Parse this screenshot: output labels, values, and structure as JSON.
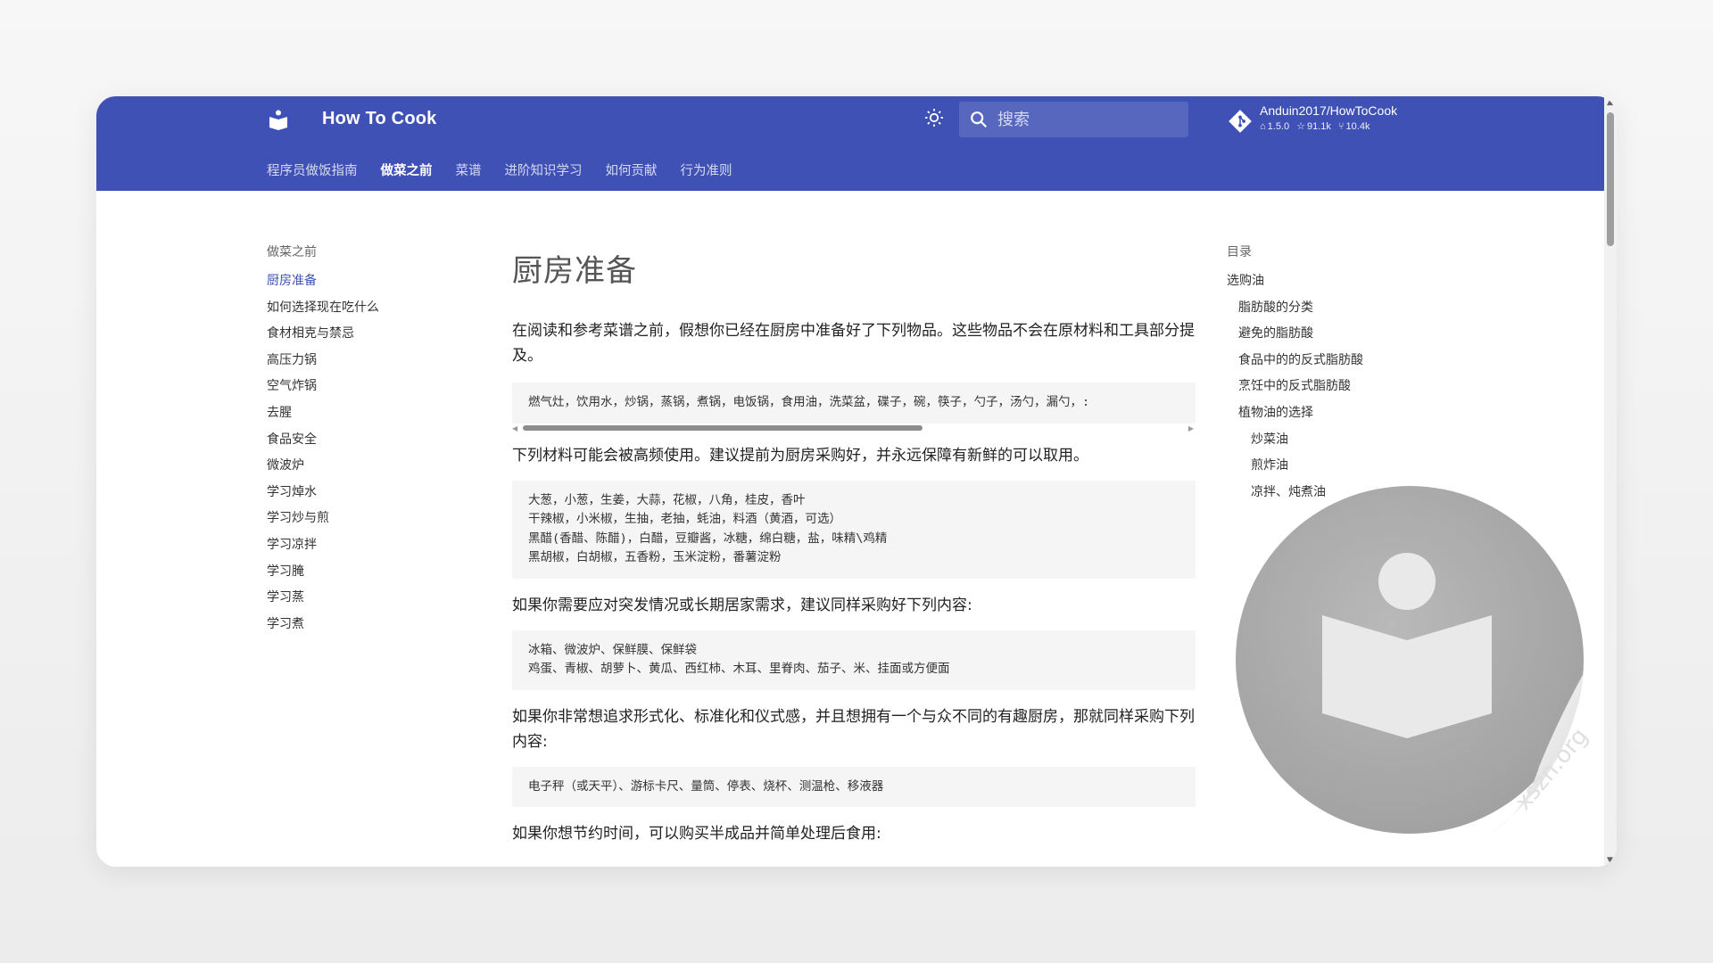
{
  "header": {
    "site_title": "How To Cook",
    "search_placeholder": "搜索",
    "repo": {
      "name": "Anduin2017/HowToCook",
      "version": "1.5.0",
      "stars": "91.1k",
      "forks": "10.4k"
    },
    "colors": {
      "primary": "#4051b5",
      "active_link": "#4051b5"
    }
  },
  "nav": {
    "tabs": [
      {
        "label": "程序员做饭指南"
      },
      {
        "label": "做菜之前",
        "active": true
      },
      {
        "label": "菜谱"
      },
      {
        "label": "进阶知识学习"
      },
      {
        "label": "如何贡献"
      },
      {
        "label": "行为准则"
      }
    ]
  },
  "sidebar": {
    "title": "做菜之前",
    "items": [
      {
        "label": "厨房准备",
        "active": true
      },
      {
        "label": "如何选择现在吃什么"
      },
      {
        "label": "食材相克与禁忌"
      },
      {
        "label": "高压力锅"
      },
      {
        "label": "空气炸锅"
      },
      {
        "label": "去腥"
      },
      {
        "label": "食品安全"
      },
      {
        "label": "微波炉"
      },
      {
        "label": "学习焯水"
      },
      {
        "label": "学习炒与煎"
      },
      {
        "label": "学习凉拌"
      },
      {
        "label": "学习腌"
      },
      {
        "label": "学习蒸"
      },
      {
        "label": "学习煮"
      }
    ]
  },
  "content": {
    "title": "厨房准备",
    "p1": "在阅读和参考菜谱之前，假想你已经在厨房中准备好了下列物品。这些物品不会在原材料和工具部分提及。",
    "code1": "燃气灶，饮用水，炒锅，蒸锅，煮锅，电饭锅，食用油，洗菜盆，碟子，碗，筷子，勺子，汤勺，漏勺，:",
    "p2": "下列材料可能会被高频使用。建议提前为厨房采购好，并永远保障有新鲜的可以取用。",
    "code2": "大葱，小葱，生姜，大蒜，花椒，八角，桂皮，香叶\n干辣椒，小米椒，生抽，老抽，蚝油，料酒（黄酒，可选）\n黑醋(香醋、陈醋)，白醋，豆瓣酱，冰糖，绵白糖，盐，味精\\鸡精\n黑胡椒，白胡椒，五香粉，玉米淀粉，番薯淀粉",
    "p3": "如果你需要应对突发情况或长期居家需求，建议同样采购好下列内容:",
    "code3": "冰箱、微波炉、保鲜膜、保鲜袋\n鸡蛋、青椒、胡萝卜、黄瓜、西红柿、木耳、里脊肉、茄子、米、挂面或方便面",
    "p4": "如果你非常想追求形式化、标准化和仪式感，并且想拥有一个与众不同的有趣厨房，那就同样采购下列内容:",
    "code4": "电子秤（或天平）、游标卡尺、量筒、停表、烧杯、测温枪、移液器",
    "p5": "如果你想节约时间，可以购买半成品并简单处理后食用:"
  },
  "toc": {
    "title": "目录",
    "items": [
      {
        "label": "选购油",
        "level": 1
      },
      {
        "label": "脂肪酸的分类",
        "level": 2
      },
      {
        "label": "避免的脂肪酸",
        "level": 2
      },
      {
        "label": "食品中的的反式脂肪酸",
        "level": 2
      },
      {
        "label": "烹饪中的反式脂肪酸",
        "level": 2
      },
      {
        "label": "植物油的选择",
        "level": 2
      },
      {
        "label": "炒菜油",
        "level": 3
      },
      {
        "label": "煎炸油",
        "level": 3
      },
      {
        "label": "凉拌、炖煮油",
        "level": 3
      }
    ]
  },
  "watermark": {
    "text": "xszn.org"
  }
}
